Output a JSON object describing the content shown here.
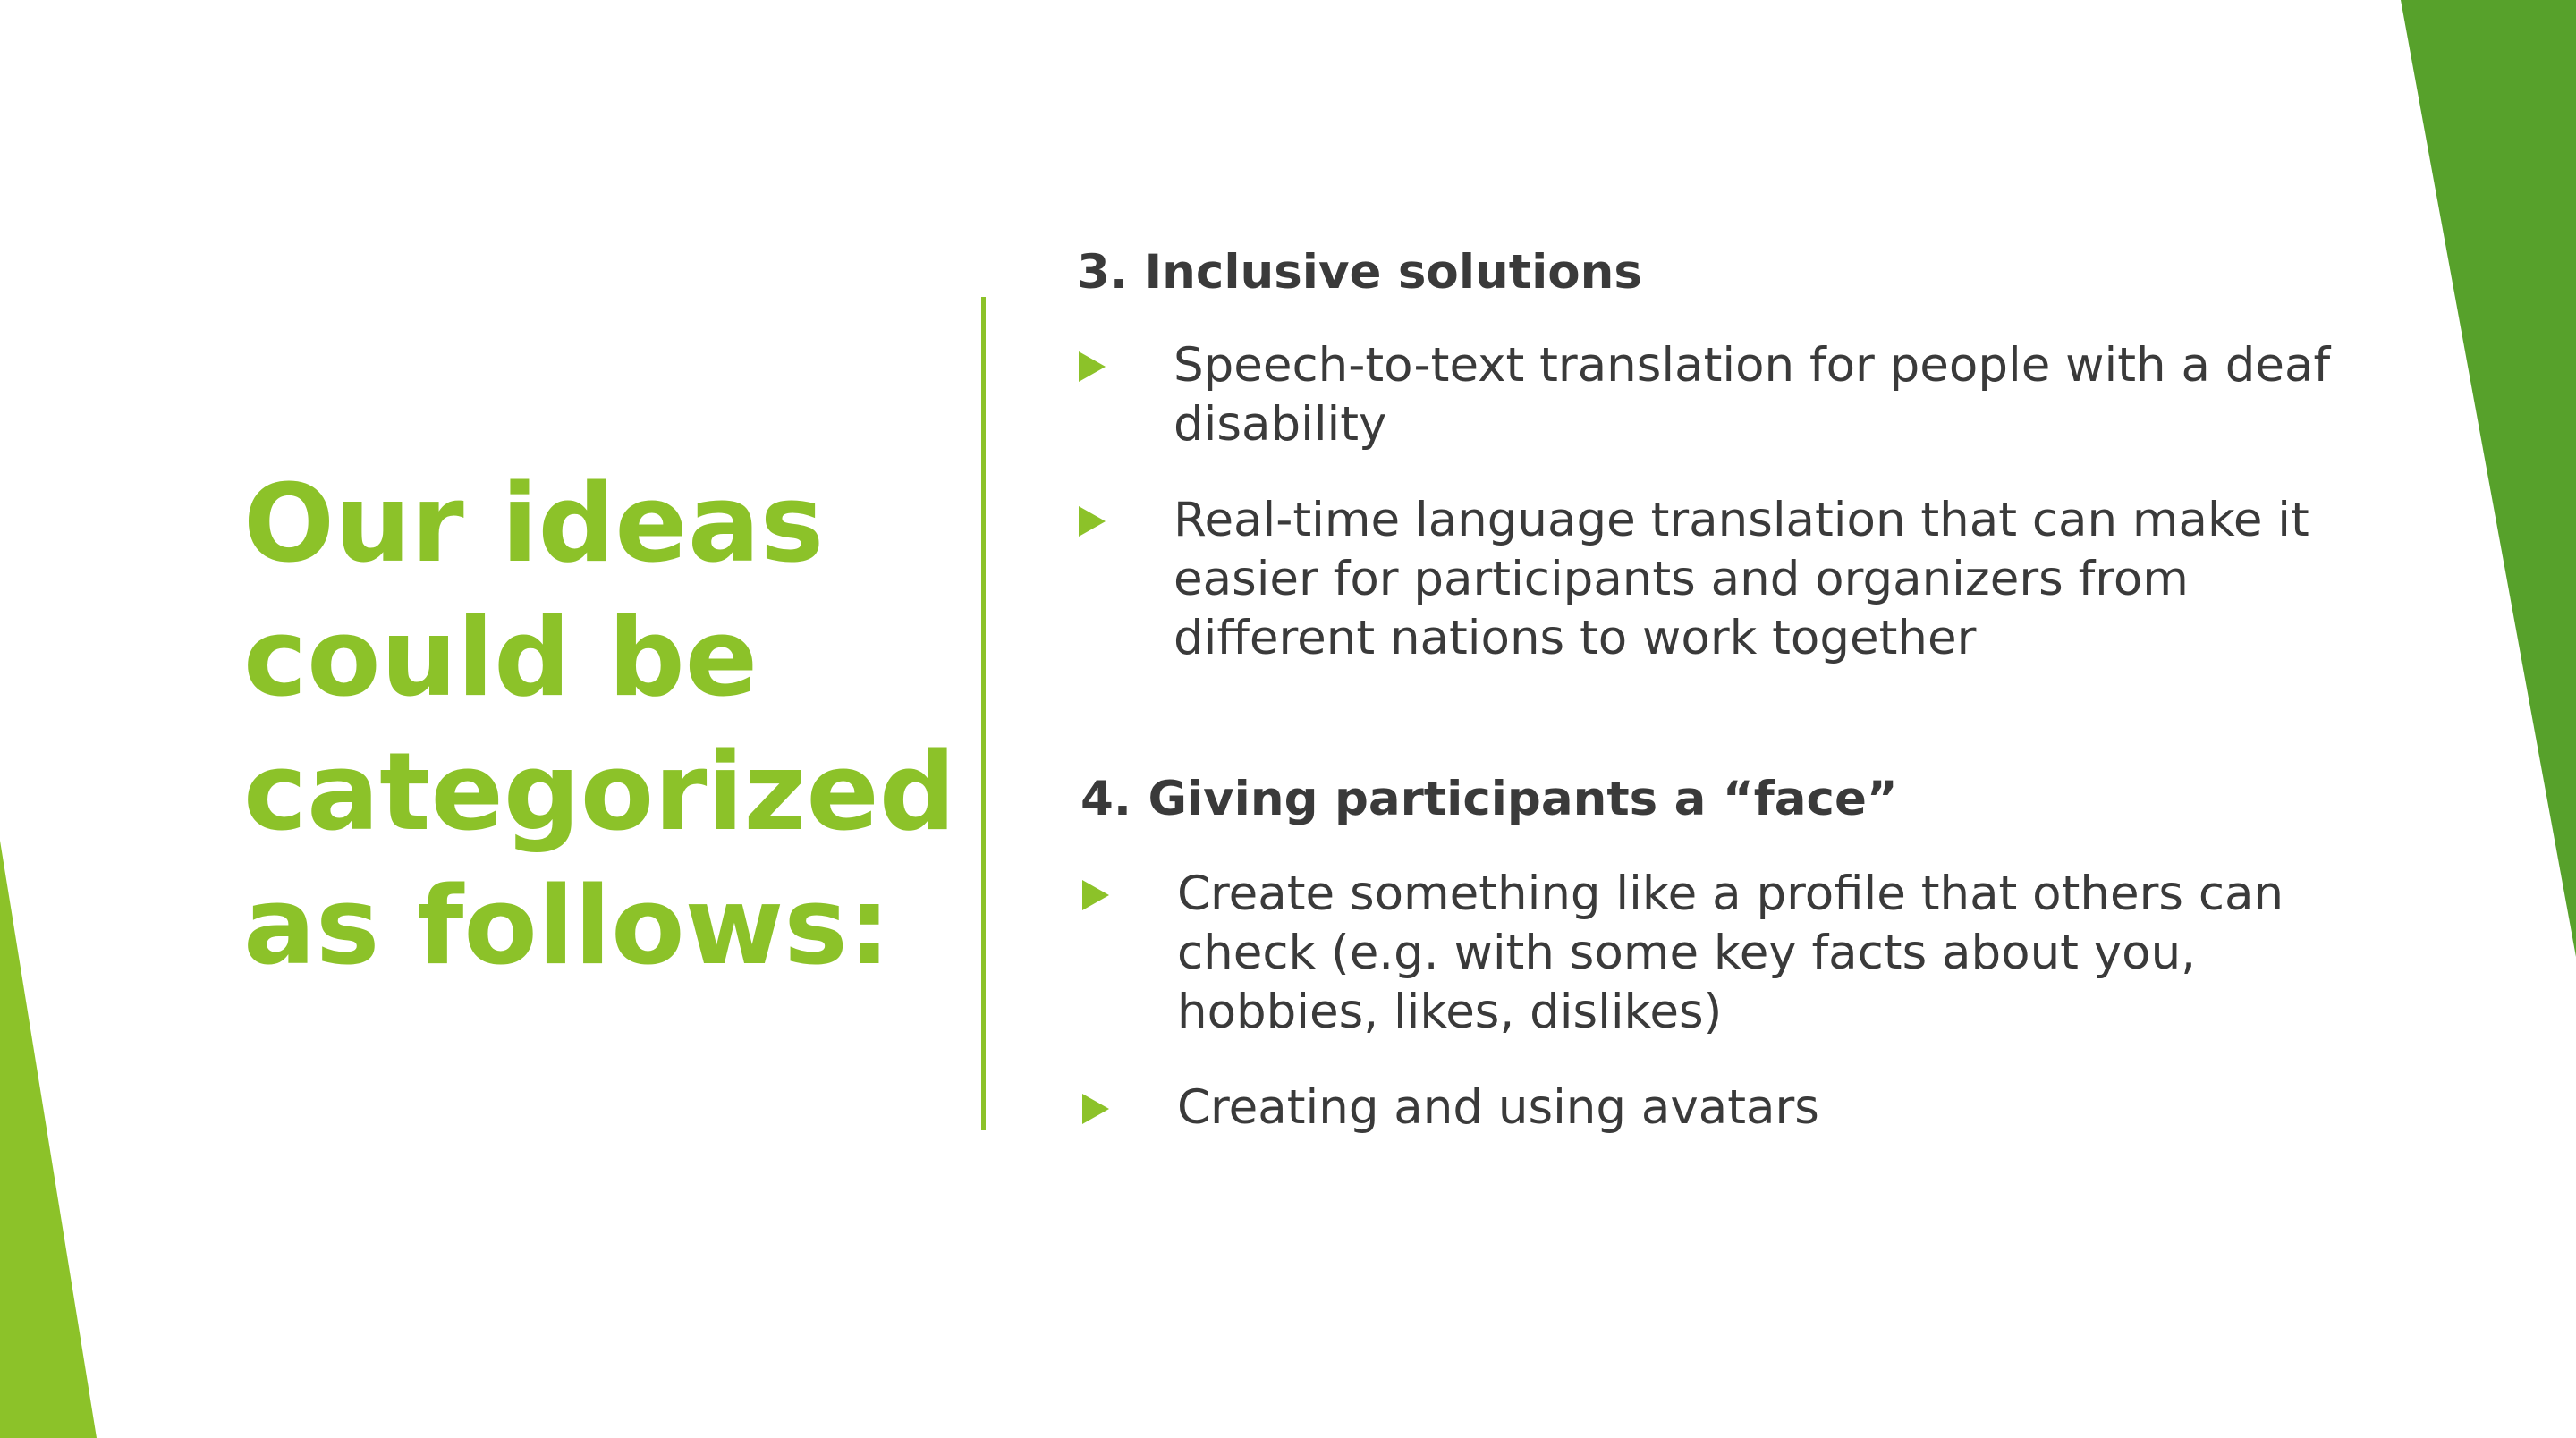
{
  "slide": {
    "title": "Our ideas\ncould be\ncategorized\nas follows:",
    "colors": {
      "accent_green": "#8cc229",
      "dark_green": "#57a12b",
      "body_text": "#3a3a3a",
      "background": "#ffffff"
    },
    "sections": [
      {
        "heading": "3. Inclusive solutions",
        "bullets": [
          "Speech-to-text translation for people with a deaf disability",
          "Real-time language translation that can make it easier for participants and organizers from different nations to work together"
        ]
      },
      {
        "heading": "4. Giving participants a “face”",
        "bullets": [
          "Create something like a profile that others can check (e.g. with some key facts about you, hobbies, likes, dislikes)",
          "Creating and using avatars"
        ]
      }
    ]
  }
}
